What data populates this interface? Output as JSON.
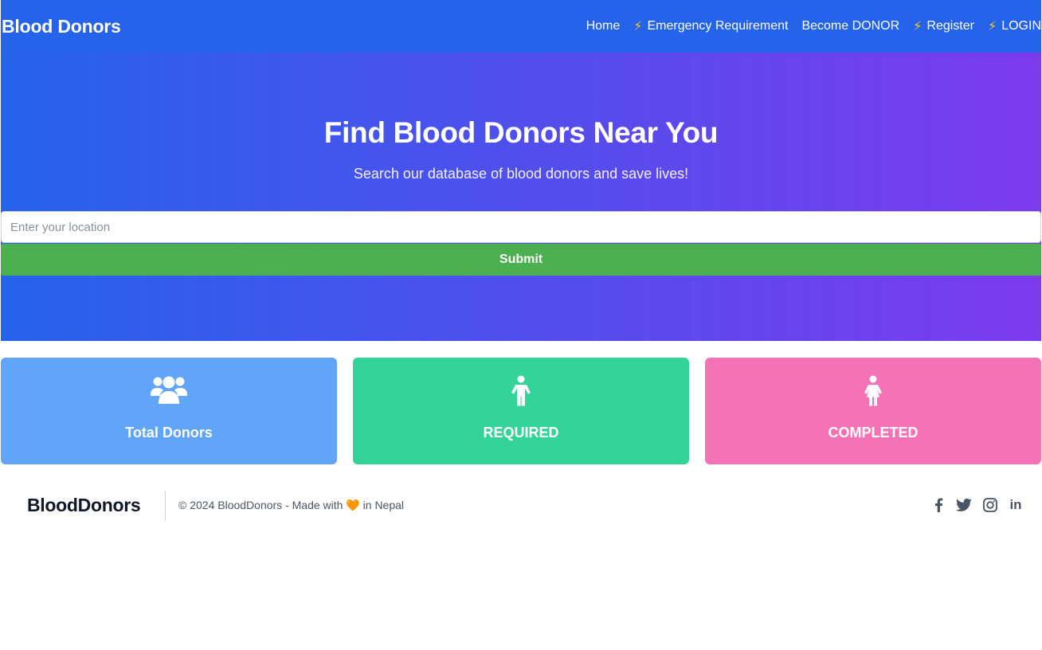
{
  "navbar": {
    "brand": "Blood Donors",
    "links": [
      {
        "label": "Home",
        "icon": ""
      },
      {
        "label": "Emergency Requirement",
        "icon": "bolt-icon"
      },
      {
        "label": "Become DONOR",
        "icon": ""
      },
      {
        "label": "Register",
        "icon": "bolt-icon"
      },
      {
        "label": "LOGIN",
        "icon": "bolt-icon"
      }
    ]
  },
  "hero": {
    "title": "Find Blood Donors Near You",
    "subtitle": "Search our database of blood donors and save lives!",
    "search": {
      "placeholder": "Enter your location",
      "value": ""
    },
    "submit_label": "Submit"
  },
  "stats": [
    {
      "label": "Total Donors",
      "icon": "users-icon",
      "color": "#60a5fa"
    },
    {
      "label": "REQUIRED",
      "icon": "child-icon",
      "color": "#34d399"
    },
    {
      "label": "COMPLETED",
      "icon": "child-dress-icon",
      "color": "#f472b6"
    }
  ],
  "footer": {
    "brand": "BloodDonors",
    "copyright_prefix": "© 2024 BloodDonors - Made with",
    "heart": "🧡",
    "copyright_suffix": "in Nepal",
    "social": [
      "facebook-icon",
      "twitter-icon",
      "instagram-icon",
      "linkedin-icon"
    ],
    "linkedin_text": "in"
  },
  "colors": {
    "navbar": "#2563eb",
    "hero_start": "#2563eb",
    "hero_end": "#7c3aed",
    "submit": "#4caf50",
    "bolt": "#facc15"
  }
}
